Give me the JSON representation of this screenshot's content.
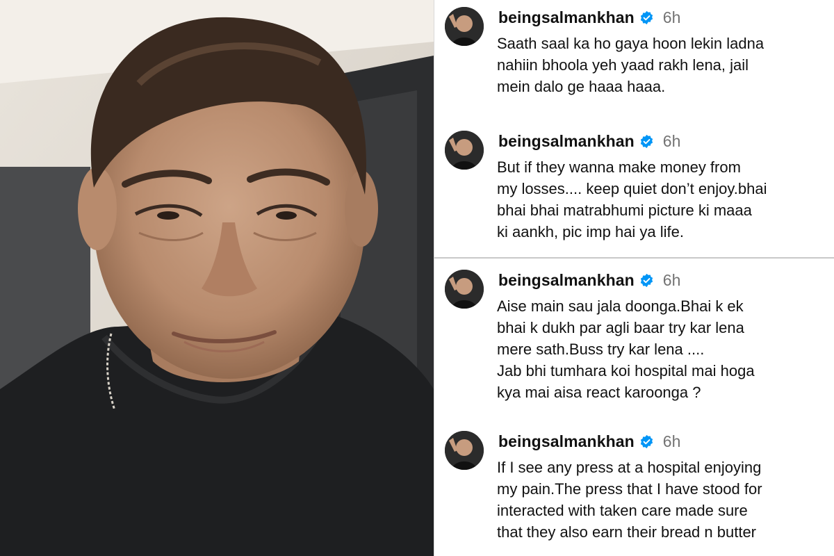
{
  "photo": {
    "icon": "selfie-photo"
  },
  "comments": [
    {
      "username": "beingsalmankhan",
      "time": "6h",
      "text": "Saath saal ka ho gaya hoon lekin ladna\nnahiin bhoola yeh yaad rakh lena, jail\nmein dalo ge haaa haaa."
    },
    {
      "username": "beingsalmankhan",
      "time": "6h",
      "text": "But  if they wanna make money from\nmy losses.... keep quiet don’t enjoy.bhai\nbhai bhai matrabhumi  picture ki maaa\nki aankh, pic imp hai ya life."
    },
    {
      "username": "beingsalmankhan",
      "time": "6h",
      "text": "Aise main sau jala doonga.Bhai k ek\nbhai k dukh par agli baar try kar lena\nmere sath.Buss try kar lena ....\nJab bhi tumhara koi hospital mai hoga\nkya mai aisa react karoonga ?"
    },
    {
      "username": "beingsalmankhan",
      "time": "6h",
      "text": "If I see any press at a hospital enjoying\nmy pain.The press that I have stood for\ninteracted with taken care made sure\nthat they also earn their bread n butter"
    }
  ],
  "colors": {
    "verified": "#0095f6",
    "time": "#737373",
    "text": "#111111"
  }
}
